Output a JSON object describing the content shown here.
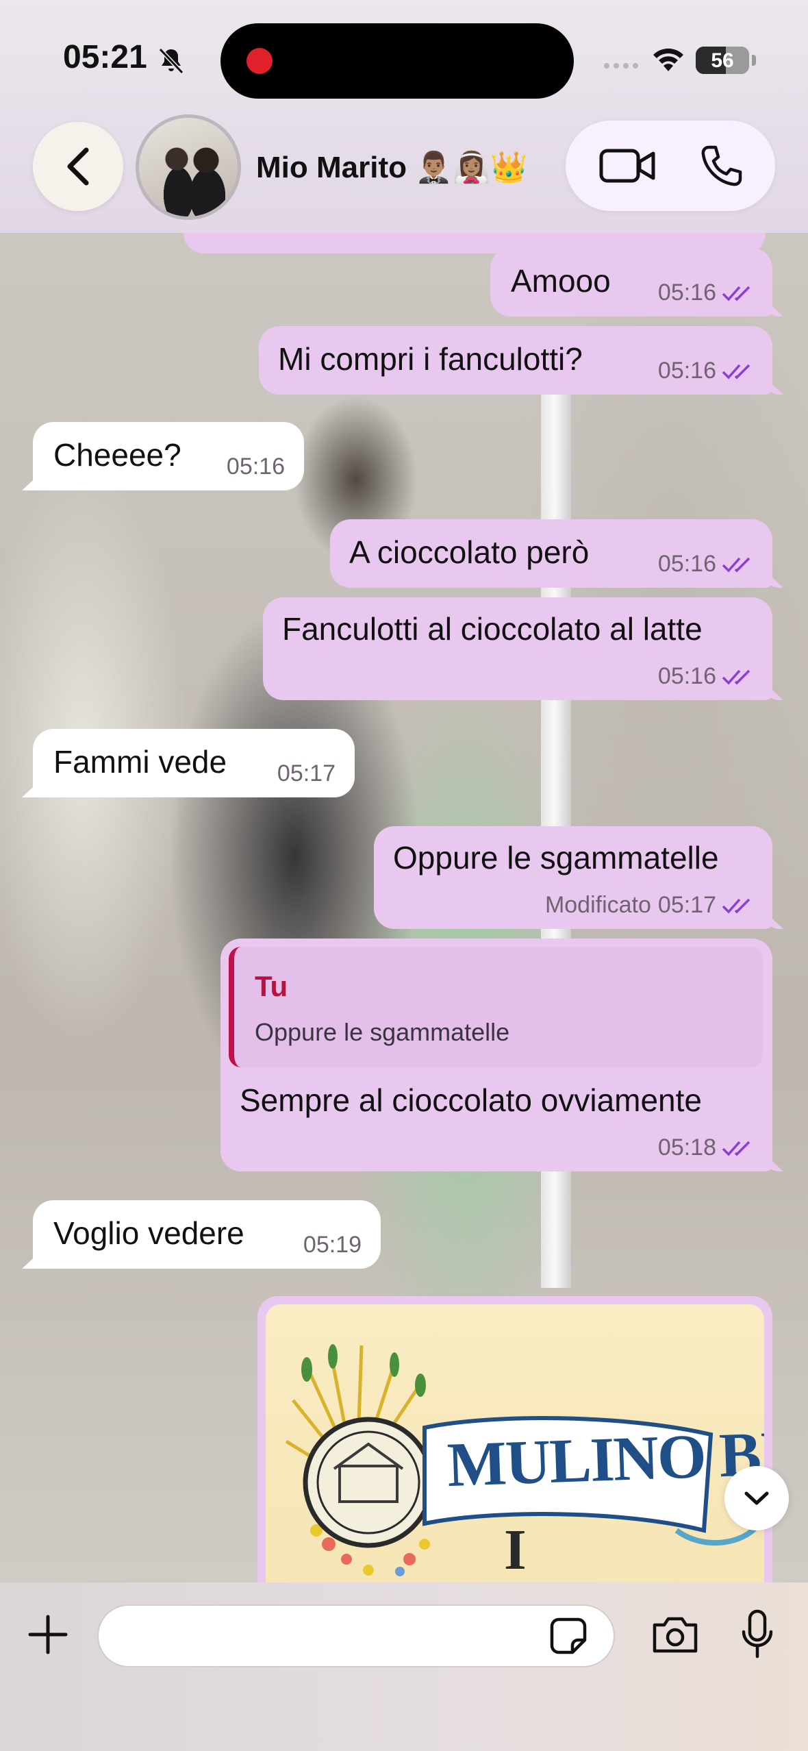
{
  "status_bar": {
    "time": "05:21",
    "battery_level": "56",
    "battery_fraction": 0.56,
    "icons": [
      "bell-off-icon",
      "signal-icon",
      "wifi-icon",
      "battery-icon"
    ]
  },
  "header": {
    "contact_name": "Mio Marito 🤵🏽‍♂️👰🏽‍♀️👑",
    "icons": [
      "chevron-left-icon",
      "video-camera-icon",
      "phone-icon"
    ]
  },
  "messages": [
    {
      "dir": "out",
      "text": "Amooo",
      "time": "05:16",
      "status": "read"
    },
    {
      "dir": "out",
      "text": "Mi compri i fanculotti?",
      "time": "05:16",
      "status": "read"
    },
    {
      "dir": "in",
      "text": "Cheeee?",
      "time": "05:16"
    },
    {
      "dir": "out",
      "text": "A cioccolato però",
      "time": "05:16",
      "status": "read"
    },
    {
      "dir": "out",
      "text": "Fanculotti al cioccolato al latte",
      "time": "05:16",
      "status": "read"
    },
    {
      "dir": "in",
      "text": "Fammi vede",
      "time": "05:17"
    },
    {
      "dir": "out",
      "text": "Oppure le sgammatelle",
      "time": "05:17",
      "edited_label": "Modificato",
      "status": "read"
    },
    {
      "dir": "out",
      "reply_to": {
        "author": "Tu",
        "text": "Oppure le sgammatelle"
      },
      "text": "Sempre al cioccolato ovviamente",
      "time": "05:18",
      "status": "read"
    },
    {
      "dir": "in",
      "text": "Voglio vedere",
      "time": "05:19"
    }
  ],
  "image_message": {
    "brand": "MULINO BIANCO",
    "sub": "I"
  },
  "composer": {
    "input_value": "",
    "icons": [
      "plus-icon",
      "sticker-icon",
      "camera-icon",
      "microphone-icon"
    ]
  },
  "colors": {
    "outgoing_bubble": "#e9c8f0",
    "incoming_bubble": "#ffffff",
    "read_ticks": "#8a3fd1",
    "reply_author": "#b8123f"
  }
}
